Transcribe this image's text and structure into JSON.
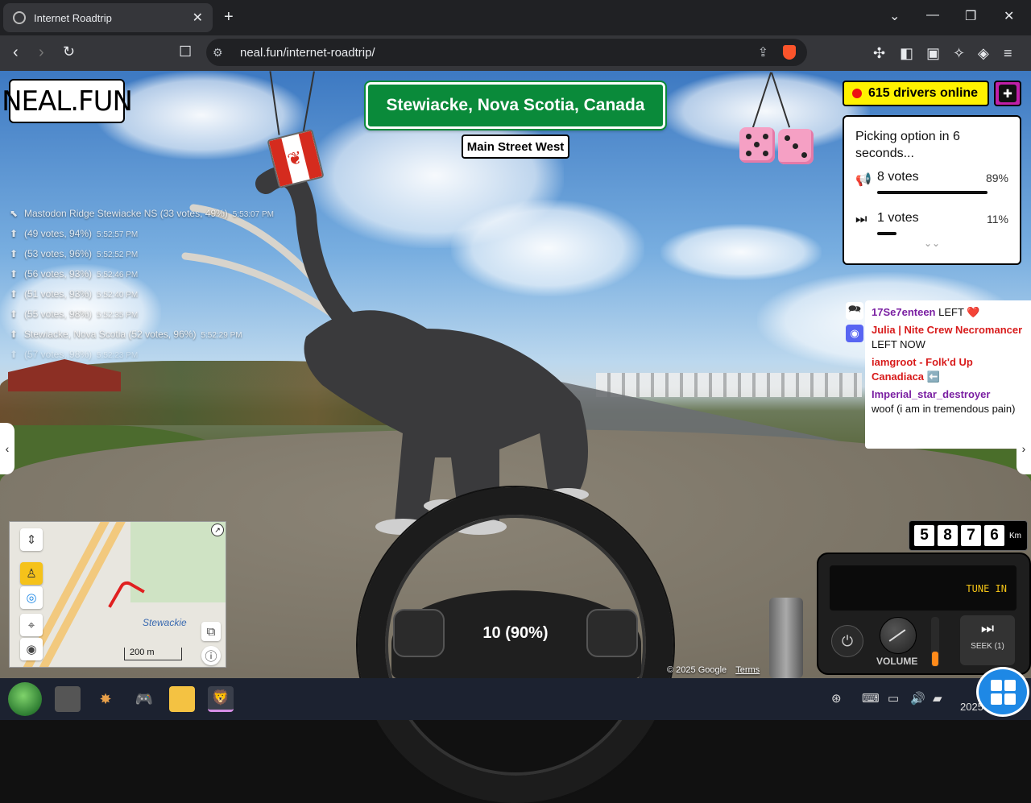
{
  "browser": {
    "tab_title": "Internet Roadtrip",
    "tab_close": "✕",
    "new_tab": "+",
    "url": "neal.fun/internet-roadtrip/",
    "window_controls": {
      "chevron": "⌄",
      "minimize": "—",
      "restore": "❐",
      "close": "✕"
    }
  },
  "page": {
    "logo": "NEAL.FUN",
    "location": "Stewiacke, Nova Scotia, Canada",
    "street": "Main Street West",
    "drivers_online": "615 drivers online",
    "vote_panel": {
      "title": "Picking option in 6 seconds...",
      "options": [
        {
          "icon": "horn-icon",
          "label": "8 votes",
          "percent": "89%",
          "share": 0.89
        },
        {
          "icon": "skip-icon",
          "label": "1 votes",
          "percent": "11%",
          "share": 0.11
        }
      ]
    },
    "history": [
      {
        "text": "Mastodon Ridge Stewiacke NS (33 votes, 49%)",
        "time": "5:53:07 PM"
      },
      {
        "text": "(49 votes, 94%)",
        "time": "5:52:57 PM"
      },
      {
        "text": "(53 votes, 96%)",
        "time": "5:52:52 PM"
      },
      {
        "text": "(56 votes, 93%)",
        "time": "5:52:46 PM"
      },
      {
        "text": "(51 votes, 93%)",
        "time": "5:52:40 PM"
      },
      {
        "text": "(55 votes, 98%)",
        "time": "5:52:35 PM"
      },
      {
        "text": "Stewiacke, Nova Scotia (52 votes, 96%)",
        "time": "5:52:29 PM"
      },
      {
        "text": "(57 votes, 98%)",
        "time": "5:52:23 PM"
      }
    ],
    "chat": [
      {
        "user": "17Se7enteen",
        "text": "LEFT ❤️",
        "color": "#7a1fa2"
      },
      {
        "user": "Julia | Nite Crew Necromancer",
        "text": "LEFT NOW",
        "color": "#d81b1b"
      },
      {
        "user": "iamgroot - Folk'd Up Canadiaca",
        "text": "⬅️",
        "color": "#d81b1b"
      },
      {
        "user": "Imperial_star_destroyer",
        "text": "woof (i am in tremendous pain)",
        "color": "#7a1fa2"
      }
    ],
    "steering_vote": "10 (90%)",
    "odometer": {
      "digits": [
        "5",
        "8",
        "7",
        "6"
      ],
      "unit": "Km"
    },
    "radio": {
      "display": "TUNE IN",
      "volume_label": "VOLUME",
      "seek_label": "SEEK (1)",
      "volume_level": 0.3
    },
    "map": {
      "place_label": "Stewackie",
      "scale": "200 m"
    },
    "attribution": {
      "copyright": "© 2025 Google",
      "terms": "Terms"
    }
  },
  "taskbar": {
    "clock_year": "2025"
  },
  "colors": {
    "sign_green": "#0a8a3a",
    "drivers_yellow": "#fff200",
    "live_dot": "#e11111",
    "radio_amber": "#f3c316"
  }
}
